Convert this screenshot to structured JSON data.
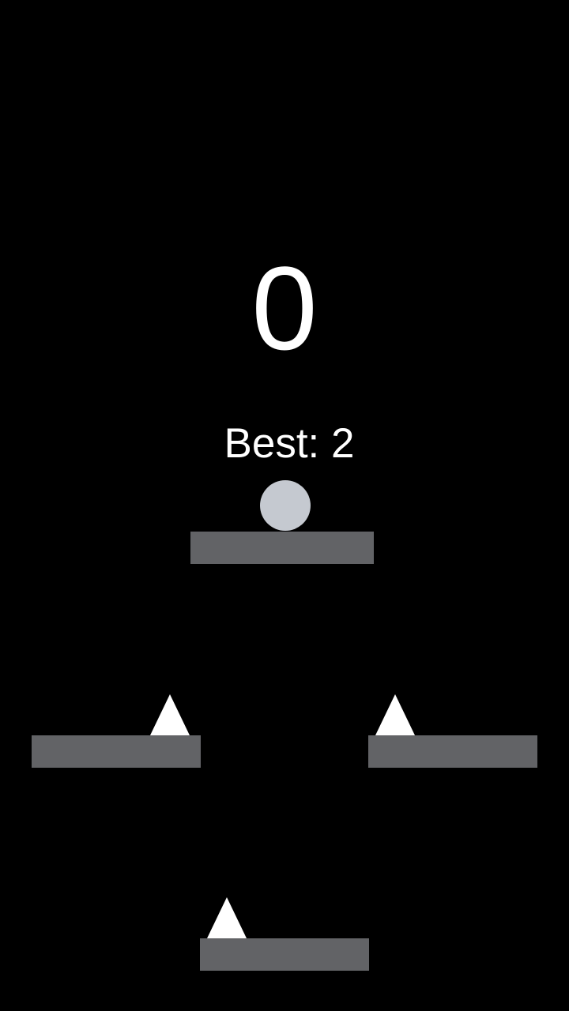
{
  "hud": {
    "score": "0",
    "best_label": "Best: 2"
  },
  "colors": {
    "background": "#000000",
    "text": "#ffffff",
    "ball": "#c5c9d0",
    "platform": "#626366",
    "spike": "#ffffff"
  },
  "entities": {
    "ball": "player-ball",
    "platforms": [
      "platform",
      "platform",
      "platform",
      "platform"
    ],
    "spikes": [
      "spike",
      "spike",
      "spike"
    ]
  }
}
